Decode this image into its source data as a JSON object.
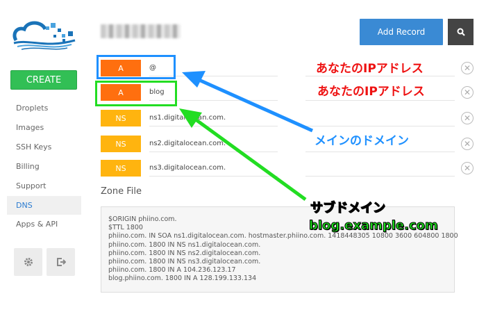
{
  "sidebar": {
    "create_label": "CREATE",
    "items": [
      {
        "label": "Droplets"
      },
      {
        "label": "Images"
      },
      {
        "label": "SSH Keys"
      },
      {
        "label": "Billing"
      },
      {
        "label": "Support"
      },
      {
        "label": "DNS",
        "active": true
      },
      {
        "label": "Apps & API"
      }
    ],
    "bottom_icons": [
      "gear-icon",
      "logout-icon"
    ]
  },
  "header": {
    "add_record_label": "Add Record",
    "search_icon": "search-icon"
  },
  "records": [
    {
      "type": "A",
      "name": "@",
      "color": "#ff6f0f"
    },
    {
      "type": "A",
      "name": "blog",
      "color": "#ff6f0f"
    },
    {
      "type": "NS",
      "name": "ns1.digitalocean.com.",
      "color": "#ffb40f"
    },
    {
      "type": "NS",
      "name": "ns2.digitalocean.com.",
      "color": "#ffb40f"
    },
    {
      "type": "NS",
      "name": "ns3.digitalocean.com.",
      "color": "#ffb40f"
    }
  ],
  "zone": {
    "label": "Zone File",
    "text": "$ORIGIN phiino.com.\n$TTL 1800\nphiino.com. IN SOA ns1.digitalocean.com. hostmaster.phiino.com. 1418448305 10800 3600 604800 1800\nphiino.com. 1800 IN NS ns1.digitalocean.com.\nphiino.com. 1800 IN NS ns2.digitalocean.com.\nphiino.com. 1800 IN NS ns3.digitalocean.com.\nphiino.com. 1800 IN A 104.236.123.17\nblog.phiino.com. 1800 IN A 128.199.133.134"
  },
  "annotations": {
    "ip1": "あなたのIPアドレス",
    "ip2": "あなたのIPアドレス",
    "main_domain": "メインのドメイン",
    "subdomain": "サブドメイン",
    "subdomain_example": "blog.example.com",
    "colors": {
      "blue": "#1e90ff",
      "green": "#22dd22",
      "red": "#ee1111"
    }
  }
}
